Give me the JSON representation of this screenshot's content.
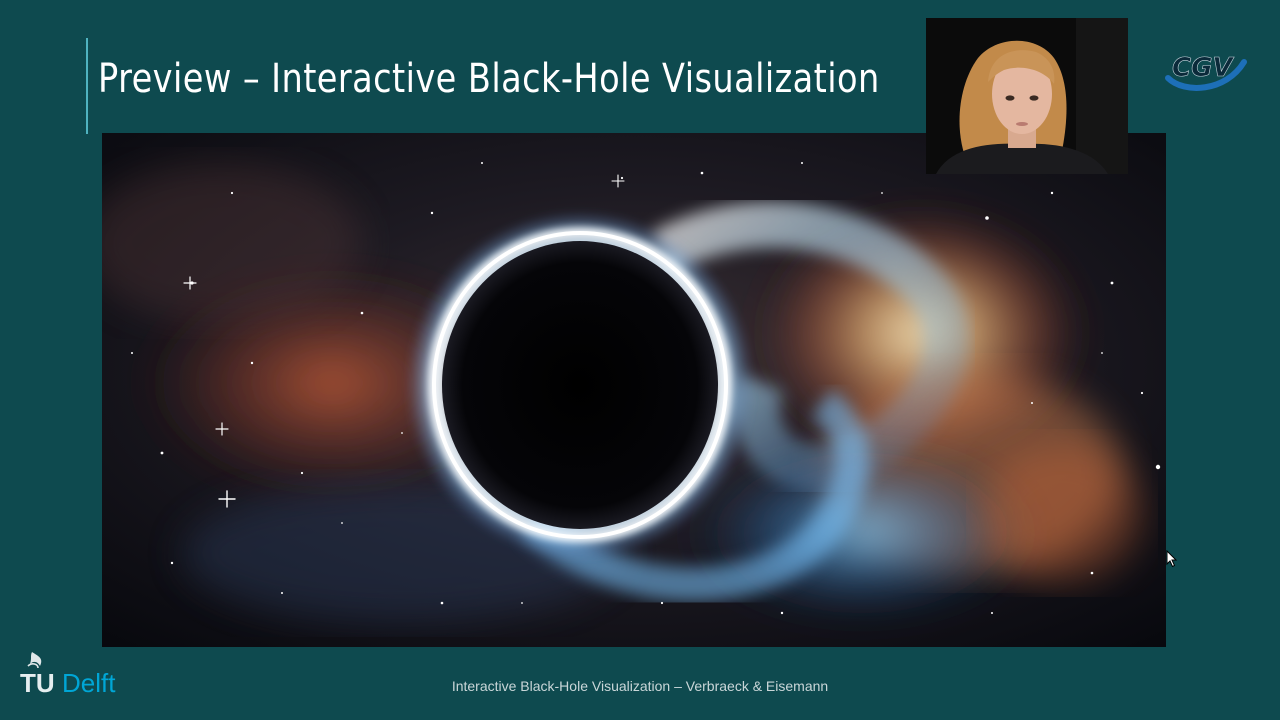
{
  "slide": {
    "title": "Preview – Interactive Black-Hole Visualization",
    "footer": "Interactive Black-Hole Visualization – Verbraeck & Eisemann",
    "logo_left_text_tu": "TU",
    "logo_left_text_delft": "Delft",
    "logo_right_text": "CGV",
    "icons": [
      "tu-delft-flame-icon",
      "cgv-logo-icon",
      "mouse-pointer-icon"
    ]
  },
  "colors": {
    "background": "#0e4a4f",
    "accent_line": "#4fb3c0",
    "title_text": "#ffffff",
    "footer_text": "#c9d6d8",
    "tud_cyan": "#00a6d6",
    "cgv_blue": "#1d6fb8"
  }
}
